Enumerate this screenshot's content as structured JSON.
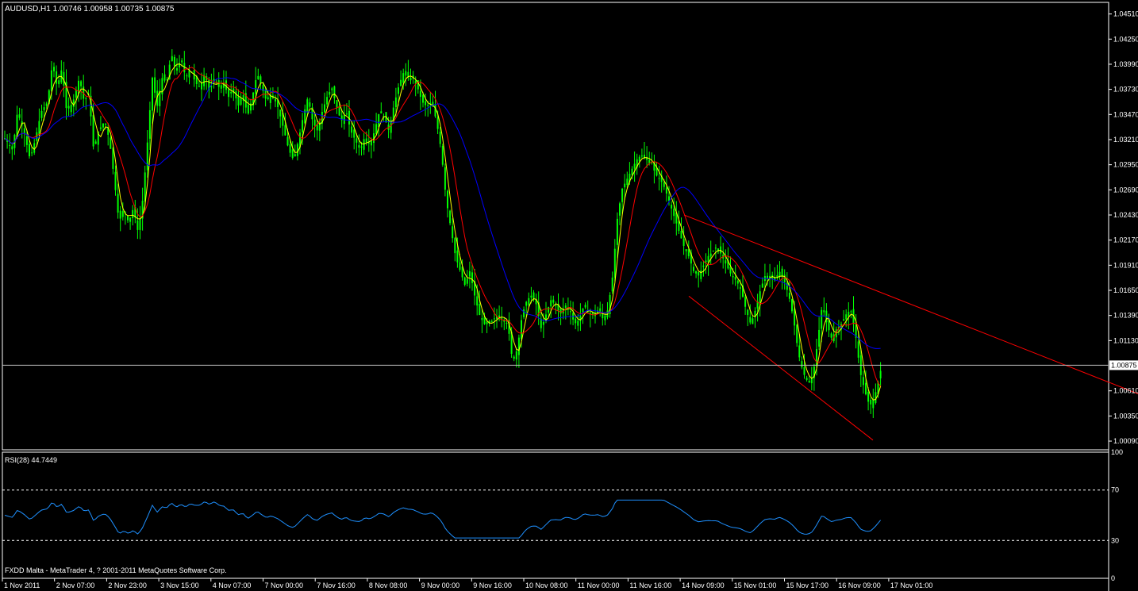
{
  "chart_data": {
    "type": "candlestick",
    "title": "AUDUSD,H1  1.00746 1.00958 1.00735 1.00875",
    "symbol": "AUDUSD,H1",
    "ohlc_current": [
      1.00746,
      1.00958,
      1.00735,
      1.00875
    ],
    "current_price": 1.00875,
    "ylim": [
      1.0,
      1.0463
    ],
    "yticks": [
      "1.04510",
      "1.04250",
      "1.03990",
      "1.03730",
      "1.03470",
      "1.03210",
      "1.02950",
      "1.02690",
      "1.02430",
      "1.02170",
      "1.01910",
      "1.01650",
      "1.01390",
      "1.01130",
      "1.00875",
      "1.00610",
      "1.00350",
      "1.00090"
    ],
    "xticks": [
      "1 Nov 2011",
      "2 Nov 07:00",
      "2 Nov 23:00",
      "3 Nov 15:00",
      "4 Nov 07:00",
      "7 Nov 00:00",
      "7 Nov 16:00",
      "8 Nov 08:00",
      "9 Nov 00:00",
      "9 Nov 16:00",
      "10 Nov 08:00",
      "11 Nov 00:00",
      "11 Nov 16:00",
      "14 Nov 09:00",
      "15 Nov 01:00",
      "15 Nov 17:00",
      "16 Nov 09:00",
      "17 Nov 01:00"
    ],
    "close_path": [
      [
        0,
        1.033
      ],
      [
        8,
        1.032
      ],
      [
        16,
        1.031
      ],
      [
        22,
        1.035
      ],
      [
        30,
        1.033
      ],
      [
        38,
        1.03
      ],
      [
        44,
        1.032
      ],
      [
        52,
        1.035
      ],
      [
        60,
        1.036
      ],
      [
        66,
        1.04
      ],
      [
        72,
        1.0375
      ],
      [
        78,
        1.0395
      ],
      [
        84,
        1.035
      ],
      [
        92,
        1.036
      ],
      [
        100,
        1.0385
      ],
      [
        106,
        1.036
      ],
      [
        112,
        1.037
      ],
      [
        118,
        1.031
      ],
      [
        124,
        1.033
      ],
      [
        132,
        1.034
      ],
      [
        138,
        1.032
      ],
      [
        144,
        1.028
      ],
      [
        150,
        1.0235
      ],
      [
        156,
        1.025
      ],
      [
        162,
        1.0235
      ],
      [
        168,
        1.025
      ],
      [
        174,
        1.0225
      ],
      [
        180,
        1.026
      ],
      [
        186,
        1.032
      ],
      [
        192,
        1.0385
      ],
      [
        198,
        1.0355
      ],
      [
        204,
        1.0385
      ],
      [
        210,
        1.038
      ],
      [
        216,
        1.041
      ],
      [
        222,
        1.039
      ],
      [
        228,
        1.0405
      ],
      [
        234,
        1.0385
      ],
      [
        240,
        1.0395
      ],
      [
        246,
        1.038
      ],
      [
        252,
        1.0375
      ],
      [
        258,
        1.039
      ],
      [
        264,
        1.037
      ],
      [
        270,
        1.0385
      ],
      [
        276,
        1.0375
      ],
      [
        282,
        1.038
      ],
      [
        288,
        1.0365
      ],
      [
        294,
        1.0375
      ],
      [
        300,
        1.0355
      ],
      [
        306,
        1.037
      ],
      [
        312,
        1.0345
      ],
      [
        318,
        1.0365
      ],
      [
        324,
        1.039
      ],
      [
        330,
        1.0375
      ],
      [
        336,
        1.036
      ],
      [
        342,
        1.037
      ],
      [
        350,
        1.0355
      ],
      [
        358,
        1.033
      ],
      [
        364,
        1.031
      ],
      [
        370,
        1.03
      ],
      [
        376,
        1.032
      ],
      [
        382,
        1.0345
      ],
      [
        388,
        1.0365
      ],
      [
        394,
        1.034
      ],
      [
        400,
        1.033
      ],
      [
        406,
        1.035
      ],
      [
        412,
        1.0365
      ],
      [
        418,
        1.0375
      ],
      [
        424,
        1.0355
      ],
      [
        430,
        1.034
      ],
      [
        436,
        1.035
      ],
      [
        442,
        1.033
      ],
      [
        448,
        1.032
      ],
      [
        454,
        1.031
      ],
      [
        460,
        1.0325
      ],
      [
        466,
        1.0315
      ],
      [
        472,
        1.033
      ],
      [
        478,
        1.035
      ],
      [
        484,
        1.0345
      ],
      [
        490,
        1.033
      ],
      [
        496,
        1.0355
      ],
      [
        502,
        1.0375
      ],
      [
        508,
        1.039
      ],
      [
        514,
        1.0385
      ],
      [
        520,
        1.0385
      ],
      [
        526,
        1.0375
      ],
      [
        532,
        1.036
      ],
      [
        538,
        1.0355
      ],
      [
        544,
        1.036
      ],
      [
        550,
        1.034
      ],
      [
        556,
        1.031
      ],
      [
        562,
        1.026
      ],
      [
        568,
        1.023
      ],
      [
        574,
        1.02
      ],
      [
        580,
        1.0185
      ],
      [
        586,
        1.017
      ],
      [
        592,
        1.0185
      ],
      [
        598,
        1.016
      ],
      [
        604,
        1.014
      ],
      [
        610,
        1.013
      ],
      [
        616,
        1.013
      ],
      [
        622,
        1.0135
      ],
      [
        628,
        1.014
      ],
      [
        634,
        1.0135
      ],
      [
        640,
        1.013
      ],
      [
        646,
        1.009
      ],
      [
        652,
        1.0105
      ],
      [
        658,
        1.014
      ],
      [
        664,
        1.0155
      ],
      [
        670,
        1.016
      ],
      [
        676,
        1.015
      ],
      [
        682,
        1.0125
      ],
      [
        688,
        1.014
      ],
      [
        694,
        1.0155
      ],
      [
        700,
        1.015
      ],
      [
        706,
        1.014
      ],
      [
        712,
        1.015
      ],
      [
        718,
        1.0145
      ],
      [
        724,
        1.013
      ],
      [
        730,
        1.0135
      ],
      [
        736,
        1.015
      ],
      [
        742,
        1.014
      ],
      [
        748,
        1.014
      ],
      [
        754,
        1.0145
      ],
      [
        760,
        1.0135
      ],
      [
        766,
        1.0145
      ],
      [
        772,
        1.018
      ],
      [
        778,
        1.024
      ],
      [
        784,
        1.027
      ],
      [
        790,
        1.028
      ],
      [
        796,
        1.029
      ],
      [
        802,
        1.03
      ],
      [
        808,
        1.0305
      ],
      [
        814,
        1.03
      ],
      [
        820,
        1.03
      ],
      [
        826,
        1.0285
      ],
      [
        832,
        1.028
      ],
      [
        838,
        1.027
      ],
      [
        844,
        1.0255
      ],
      [
        850,
        1.024
      ],
      [
        856,
        1.0225
      ],
      [
        862,
        1.021
      ],
      [
        868,
        1.02
      ],
      [
        874,
        1.0185
      ],
      [
        880,
        1.018
      ],
      [
        886,
        1.019
      ],
      [
        892,
        1.02
      ],
      [
        898,
        1.0205
      ],
      [
        904,
        1.021
      ],
      [
        910,
        1.02
      ],
      [
        916,
        1.019
      ],
      [
        922,
        1.018
      ],
      [
        928,
        1.0175
      ],
      [
        934,
        1.0165
      ],
      [
        940,
        1.0145
      ],
      [
        946,
        1.013
      ],
      [
        952,
        1.0145
      ],
      [
        958,
        1.0165
      ],
      [
        964,
        1.018
      ],
      [
        970,
        1.018
      ],
      [
        976,
        1.0175
      ],
      [
        982,
        1.0185
      ],
      [
        988,
        1.0175
      ],
      [
        994,
        1.016
      ],
      [
        1000,
        1.0135
      ],
      [
        1006,
        1.01
      ],
      [
        1012,
        1.008
      ],
      [
        1018,
        1.007
      ],
      [
        1024,
        1.0075
      ],
      [
        1030,
        1.011
      ],
      [
        1036,
        1.015
      ],
      [
        1042,
        1.013
      ],
      [
        1048,
        1.0115
      ],
      [
        1054,
        1.0125
      ],
      [
        1060,
        1.013
      ],
      [
        1066,
        1.014
      ],
      [
        1072,
        1.0145
      ],
      [
        1078,
        1.012
      ],
      [
        1084,
        1.008
      ],
      [
        1090,
        1.006
      ],
      [
        1096,
        1.0045
      ],
      [
        1102,
        1.0055
      ],
      [
        1108,
        1.0075
      ],
      [
        1111,
        1.00875
      ]
    ],
    "overlays": [
      {
        "color": "#ffff00",
        "window": 4
      },
      {
        "color": "#ff0000",
        "window": 10
      },
      {
        "color": "#0000ff",
        "window": 28
      }
    ],
    "trendlines": [
      {
        "color": "#ff0000",
        "points": [
          [
            862,
            1.0243
          ],
          [
            1434,
            1.0058
          ]
        ]
      },
      {
        "color": "#ff0000",
        "points": [
          [
            868,
            1.0159
          ],
          [
            1100,
            1.001
          ]
        ]
      }
    ],
    "indicator": {
      "label": "RSI(28) 44.7449",
      "name": "RSI(28)",
      "value": 44.7449,
      "ylim": [
        0,
        100
      ],
      "levels": [
        30,
        70
      ],
      "yticks": [
        "100",
        "70",
        "30",
        "0"
      ]
    },
    "colors": {
      "background": "#000000",
      "grid_text": "#ffffff",
      "candle": "#00ff00",
      "rsi_line": "#1e90ff",
      "current_line": "#c0c0c0"
    }
  },
  "footer": {
    "text": "FXDD Malta - MetaTrader 4, ? 2001-2011 MetaQuotes Software Corp."
  }
}
